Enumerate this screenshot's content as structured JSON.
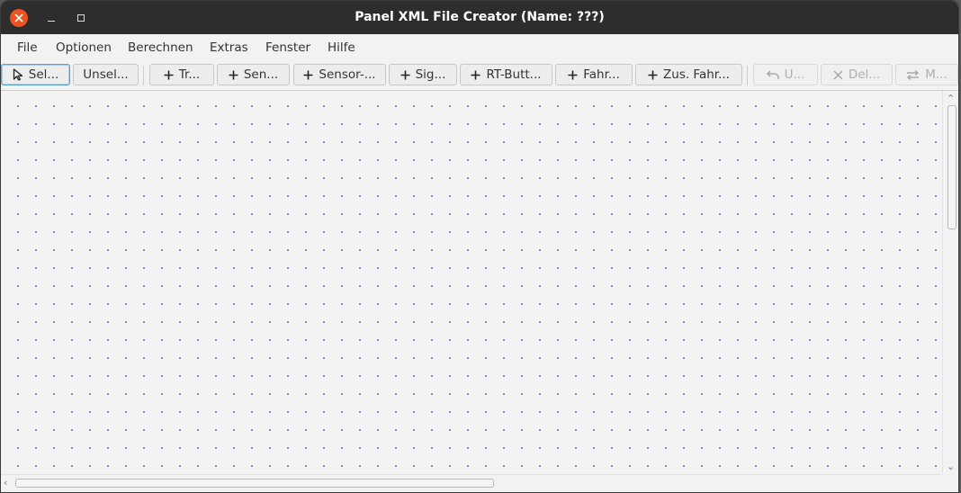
{
  "window": {
    "title": "Panel XML File Creator (Name: ???)"
  },
  "menu": [
    {
      "label": "File"
    },
    {
      "label": "Optionen"
    },
    {
      "label": "Berechnen"
    },
    {
      "label": "Extras"
    },
    {
      "label": "Fenster"
    },
    {
      "label": "Hilfe"
    }
  ],
  "toolbar": {
    "select": {
      "label": "Sel...",
      "icon": "cursor-arrow-icon",
      "selected": true
    },
    "unselect": {
      "label": "Unsel..."
    },
    "add_track": {
      "label": "Tr...",
      "icon": "plus-icon"
    },
    "add_sensor": {
      "label": "Sen...",
      "icon": "plus-icon"
    },
    "add_sensor_group": {
      "label": "Sensor-...",
      "icon": "plus-icon"
    },
    "add_signal": {
      "label": "Sig...",
      "icon": "plus-icon"
    },
    "add_rt_button": {
      "label": "RT-Butt...",
      "icon": "plus-icon"
    },
    "add_route": {
      "label": "Fahr...",
      "icon": "plus-icon"
    },
    "add_extra_route": {
      "label": "Zus. Fahr...",
      "icon": "plus-icon"
    },
    "undo": {
      "label": "U...",
      "icon": "undo-icon",
      "disabled": true
    },
    "delete": {
      "label": "Del...",
      "icon": "close-x-icon",
      "disabled": true
    },
    "move": {
      "label": "M...",
      "icon": "swap-arrows-icon",
      "disabled": true
    }
  },
  "colors": {
    "titlebar_bg": "#2d2d2d",
    "close_button": "#e95420",
    "grid_dot": "#7a6ee0",
    "canvas_bg": "#f3f3f3"
  }
}
